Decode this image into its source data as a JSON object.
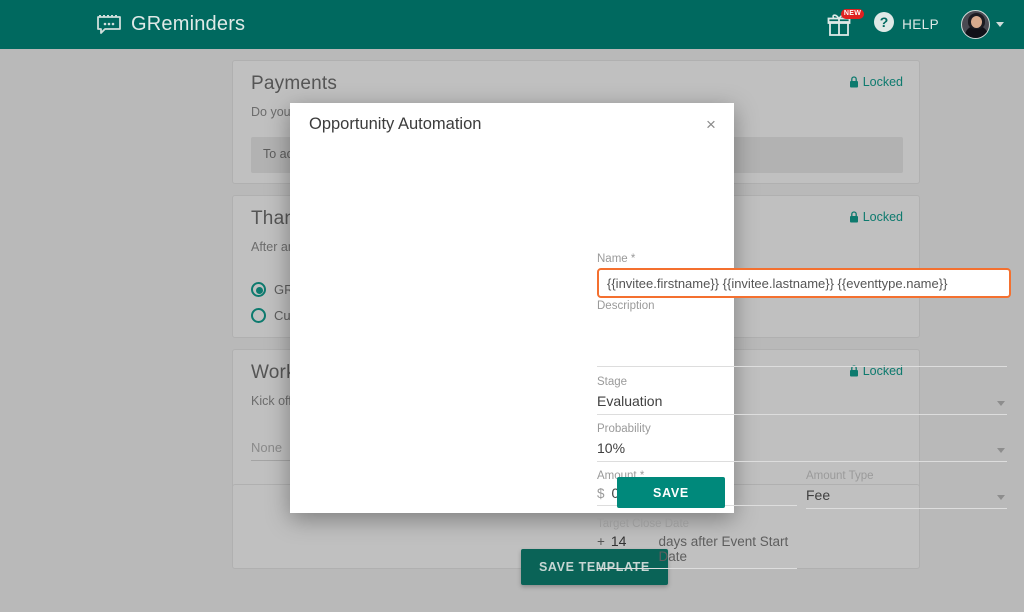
{
  "navbar": {
    "brand": "GReminders",
    "brand_icon": "calendar-chat-icon",
    "gift_icon": "gift-icon",
    "gift_badge": "NEW",
    "help_icon": "question-mark-icon",
    "help_label": "HELP",
    "avatar_icon": "user-avatar",
    "avatar_caret": "chevron-down-icon",
    "bg_color": "#00695f"
  },
  "cards": [
    {
      "title": "Payments",
      "description": "Do you w                                                        proval Option.",
      "locked_label": "Locked",
      "lock_icon": "padlock-icon",
      "info_text": "To ac"
    },
    {
      "title": "Thank",
      "description": "After an                                                         ustomer to a specific",
      "locked_label": "Locked",
      "lock_icon": "padlock-icon",
      "radios": [
        {
          "label": "GRem",
          "checked": true
        },
        {
          "label": "Cust",
          "checked": false
        }
      ]
    },
    {
      "title": "Workfl",
      "description": "Kick off                                                            th Redtail, Wealthb",
      "locked_label": "Locked",
      "lock_icon": "padlock-icon",
      "select_value": "None"
    }
  ],
  "save_template_label": "SAVE TEMPLATE",
  "modal": {
    "title": "Opportunity Automation",
    "close_icon": "close-icon",
    "name": {
      "label": "Name *",
      "value": "{{invitee.firstname}} {{invitee.lastname}} {{eventtype.name}}",
      "border_color": "#f4702f"
    },
    "description": {
      "label": "Description",
      "value": ""
    },
    "stage": {
      "label": "Stage",
      "value": "Evaluation",
      "caret": "chevron-down-icon"
    },
    "probability": {
      "label": "Probability",
      "value": "10%",
      "caret": "chevron-down-icon"
    },
    "amount": {
      "label": "Amount *",
      "currency": "$",
      "value": "0"
    },
    "amount_type": {
      "label": "Amount Type",
      "value": "Fee",
      "caret": "chevron-down-icon"
    },
    "target_close_date": {
      "label": "Target Close Date",
      "sign": "+",
      "days": "14",
      "suffix": "days after Event Start Date"
    },
    "save_label": "SAVE",
    "save_color": "#00897b"
  }
}
